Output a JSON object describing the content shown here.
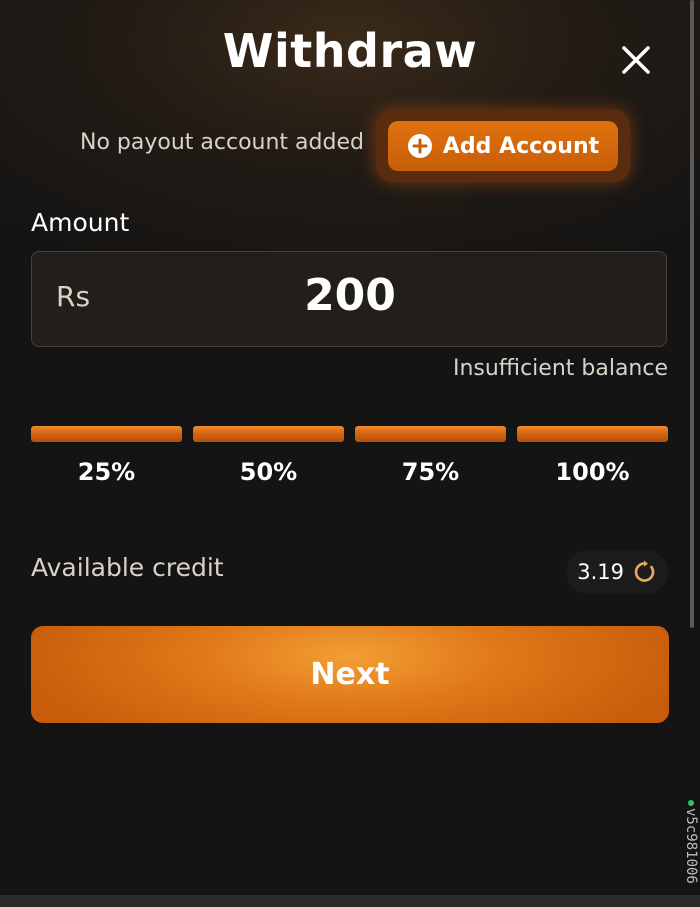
{
  "header": {
    "title": "Withdraw",
    "close_icon": "close-icon"
  },
  "payout": {
    "message": "No payout account added",
    "add_button_label": "Add Account",
    "add_icon": "plus-circle-icon"
  },
  "amount": {
    "label": "Amount",
    "currency": "Rs",
    "value": "200",
    "error": "Insufficient balance"
  },
  "quick_percent": [
    {
      "label": "25%"
    },
    {
      "label": "50%"
    },
    {
      "label": "75%"
    },
    {
      "label": "100%"
    }
  ],
  "credit": {
    "label": "Available credit",
    "value": "3.19",
    "refresh_icon": "refresh-icon"
  },
  "next_button": {
    "label": "Next"
  },
  "footer": {
    "version": "v5c981006"
  },
  "colors": {
    "accent": "#d9680f",
    "background": "#141414",
    "status_dot": "#2ec46e"
  }
}
